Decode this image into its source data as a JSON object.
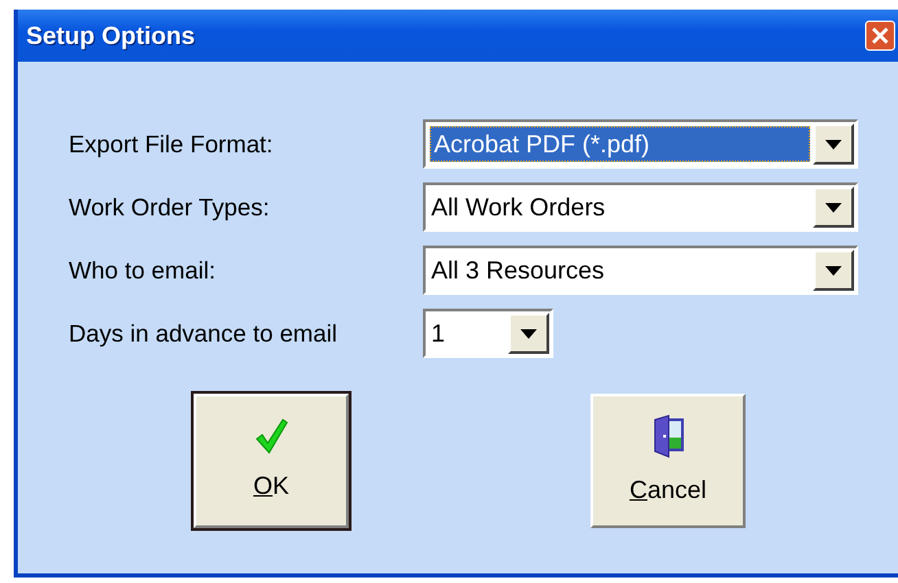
{
  "window": {
    "title": "Setup Options"
  },
  "fields": [
    {
      "label": "Export File Format:",
      "value": "Acrobat PDF (*.pdf)",
      "focused": true,
      "kind": "wide"
    },
    {
      "label": "Work Order Types:",
      "value": "All Work Orders",
      "focused": false,
      "kind": "wide"
    },
    {
      "label": "Who to email:",
      "value": "All 3 Resources",
      "focused": false,
      "kind": "wide"
    },
    {
      "label": "Days in advance to email",
      "value": "1",
      "focused": false,
      "kind": "narrow"
    }
  ],
  "buttons": [
    {
      "mnemonic": "O",
      "rest": "K",
      "kind": "ok",
      "default": true
    },
    {
      "mnemonic": "C",
      "rest": "ancel",
      "kind": "cancel",
      "default": false
    }
  ]
}
